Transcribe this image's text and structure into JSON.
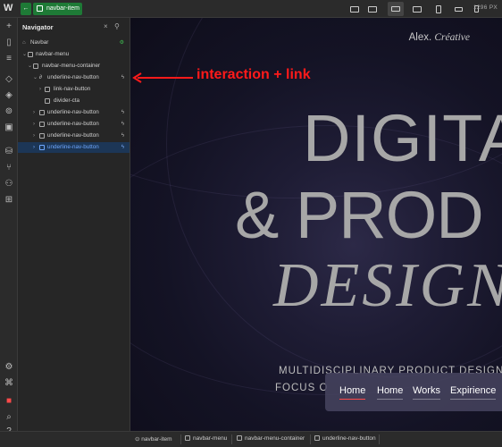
{
  "topbar": {
    "logo_icon": "webflow-logo-icon",
    "back_icon": "back-arrow-icon",
    "element_name": "navbar-item",
    "width_readout": "1296 PX",
    "devices": [
      "desktop-icon",
      "desktop-icon",
      "laptop-icon",
      "laptop-icon",
      "tablet-icon",
      "mobile-landscape-icon",
      "mobile-portrait-icon"
    ]
  },
  "navigator": {
    "title": "Navigator",
    "close_label": "×",
    "pin_icon": "pin-icon",
    "tree": [
      {
        "label": "Navbar",
        "bolt": ""
      },
      {
        "label": "navbar-menu",
        "bolt": ""
      },
      {
        "label": "navbar-menu-container",
        "bolt": ""
      },
      {
        "label": "underline-nav-button",
        "bolt": "ϟ"
      },
      {
        "label": "link-nav-button",
        "bolt": ""
      },
      {
        "label": "divider-cta",
        "bolt": ""
      },
      {
        "label": "underline-nav-button",
        "bolt": "ϟ"
      },
      {
        "label": "underline-nav-button",
        "bolt": "ϟ"
      },
      {
        "label": "underline-nav-button",
        "bolt": "ϟ"
      },
      {
        "label": "underline-nav-button",
        "bolt": "ϟ"
      }
    ]
  },
  "annotation": {
    "text": "interaction + link",
    "color": "#ff1a1a"
  },
  "canvas": {
    "brand_prefix": "Alex.",
    "brand_suffix": "Créative",
    "heading_1": "DIGITA",
    "heading_2": "& PROD",
    "heading_3": "DESIGN",
    "sub_1": "MULTIDISCIPLINARY PRODUCT DESIGNER",
    "sub_2": "FOCUS O",
    "menu": [
      "Home",
      "Home",
      "Works",
      "Expirience"
    ]
  },
  "breadcrumb": [
    "navbar-item",
    "navbar-menu",
    "navbar-menu-container",
    "underline-nav-button"
  ],
  "colors": {
    "accent_green": "#1e7a36",
    "selected_blue": "#6fa8ff",
    "active_underline": "#ff4a4a"
  }
}
